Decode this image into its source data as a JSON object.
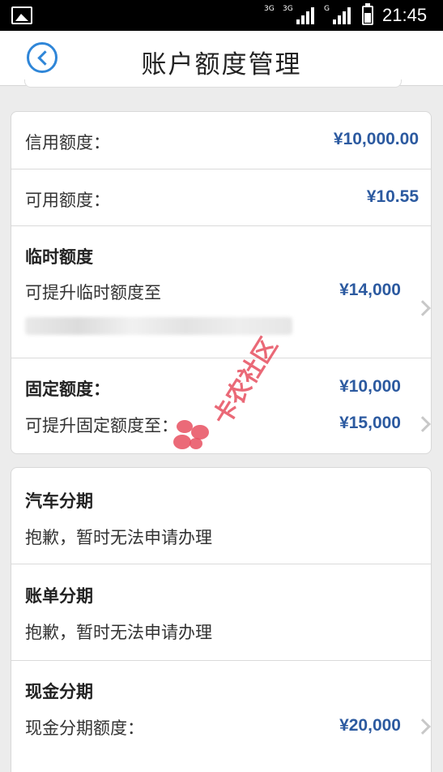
{
  "statusbar": {
    "sim1_tag": "3G",
    "sim2_tag": "3G",
    "sim3_tag": "G",
    "time": "21:45",
    "icons": [
      "image-icon",
      "signal-icon",
      "signal-icon",
      "battery-icon"
    ]
  },
  "header": {
    "title": "账户额度管理",
    "back_icon": "back-circle-icon",
    "accent": "#2f86d8"
  },
  "limits": {
    "credit_label": "信用额度：",
    "credit_value": "¥10,000.00",
    "available_label": "可用额度：",
    "available_value": "¥10.55",
    "temp_title": "临时额度",
    "temp_raise_label": "可提升临时额度至",
    "temp_raise_value": "¥14,000",
    "fixed_title": "固定额度：",
    "fixed_value": "¥10,000",
    "fixed_raise_label": "可提升固定额度至：",
    "fixed_raise_value": "¥15,000"
  },
  "installments": {
    "car_title": "汽车分期",
    "car_text": "抱歉，暂时无法申请办理",
    "bill_title": "账单分期",
    "bill_text": "抱歉，暂时无法申请办理",
    "cash_title": "现金分期",
    "cash_label": "现金分期额度：",
    "cash_value": "¥20,000"
  },
  "watermark": {
    "text": "卡农社区"
  },
  "colors": {
    "amount": "#2c5aa0",
    "watermark": "#e75060"
  }
}
